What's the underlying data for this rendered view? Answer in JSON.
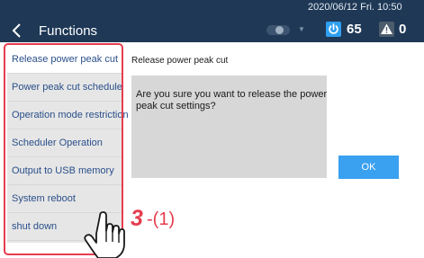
{
  "header": {
    "title": "Functions",
    "datetime": "2020/06/12 Fri. 10:50",
    "power_count": "65",
    "warning_count": "0",
    "icons": {
      "back": "chevron-left-icon",
      "power": "power-icon",
      "warning": "warning-icon",
      "toggle": "toggle-icon",
      "dropdown": "chevron-down-icon"
    }
  },
  "sidebar": {
    "items": [
      {
        "label": "Release power peak cut",
        "active": true
      },
      {
        "label": "Power peak cut schedule",
        "active": false
      },
      {
        "label": "Operation mode restriction",
        "active": false
      },
      {
        "label": "Scheduler Operation",
        "active": false
      },
      {
        "label": "Output to USB memory",
        "active": false
      },
      {
        "label": "System reboot",
        "active": false
      },
      {
        "label": "shut down",
        "active": false
      }
    ]
  },
  "panel": {
    "heading": "Release power peak cut",
    "message": "Are you sure you want to release the power peak cut settings?",
    "ok_label": "OK"
  },
  "annotation": {
    "step_number": "3",
    "step_sub": "-(1)",
    "icon": "hand-pointer-icon"
  },
  "colors": {
    "header_bg": "#1e3856",
    "accent_blue": "#3aa0f0",
    "annotation_red": "#e53d4f",
    "sidebar_bg": "#e6e6e6",
    "dialog_bg": "#d7d7d7"
  }
}
